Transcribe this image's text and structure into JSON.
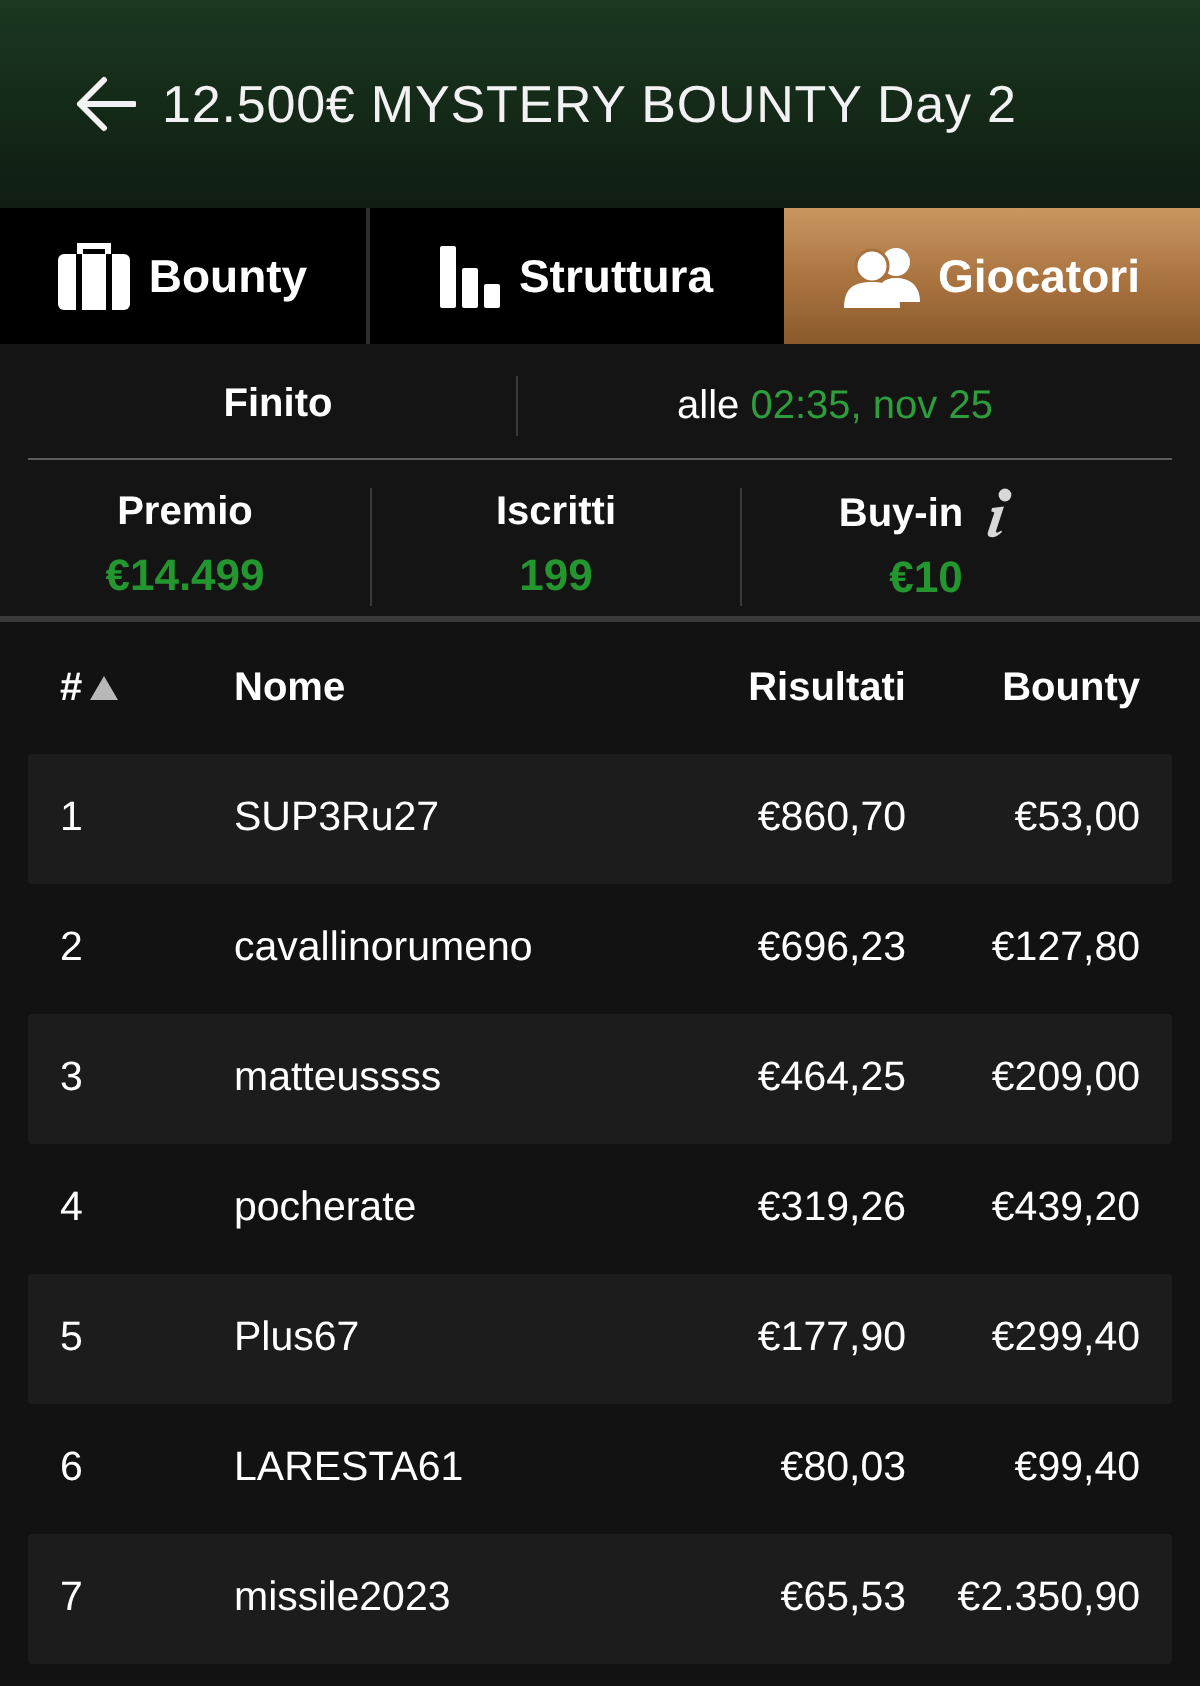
{
  "header": {
    "title": "12.500€ MYSTERY BOUNTY Day 2"
  },
  "tabs": [
    {
      "label": "Bounty",
      "selected": false
    },
    {
      "label": "Struttura",
      "selected": false
    },
    {
      "label": "Giocatori",
      "selected": true
    }
  ],
  "status": {
    "state": "Finito",
    "time_prefix": "alle",
    "time": "02:35, nov 25"
  },
  "stats": [
    {
      "label": "Premio",
      "value": "€14.499",
      "info": false
    },
    {
      "label": "Iscritti",
      "value": "199",
      "info": false
    },
    {
      "label": "Buy-in",
      "value": "€10",
      "info": true
    }
  ],
  "table": {
    "columns": [
      {
        "label": "#",
        "sorted": true
      },
      {
        "label": "Nome",
        "sorted": false
      },
      {
        "label": "Risultati",
        "sorted": false
      },
      {
        "label": "Bounty",
        "sorted": false
      }
    ],
    "rows": [
      {
        "rank": "1",
        "name": "SUP3Ru27",
        "result": "€860,70",
        "bounty": "€53,00"
      },
      {
        "rank": "2",
        "name": "cavallinorumeno",
        "result": "€696,23",
        "bounty": "€127,80"
      },
      {
        "rank": "3",
        "name": "matteussss",
        "result": "€464,25",
        "bounty": "€209,00"
      },
      {
        "rank": "4",
        "name": "pocherate",
        "result": "€319,26",
        "bounty": "€439,20"
      },
      {
        "rank": "5",
        "name": "Plus67",
        "result": "€177,90",
        "bounty": "€299,40"
      },
      {
        "rank": "6",
        "name": "LARESTA61",
        "result": "€80,03",
        "bounty": "€99,40"
      },
      {
        "rank": "7",
        "name": "missile2023",
        "result": "€65,53",
        "bounty": "€2.350,90"
      }
    ]
  }
}
